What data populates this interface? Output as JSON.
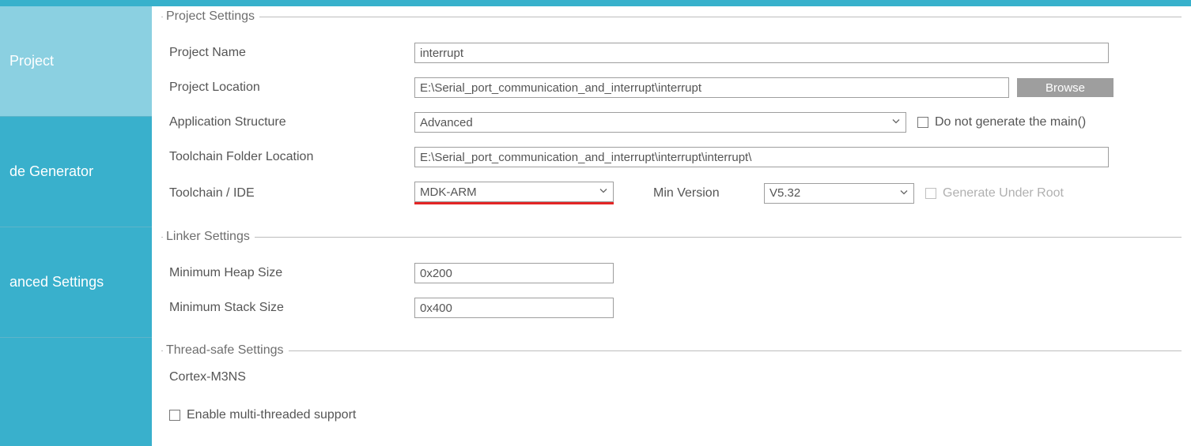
{
  "sidebar": {
    "items": [
      {
        "label": "Project"
      },
      {
        "label": "de Generator"
      },
      {
        "label": "anced Settings"
      }
    ]
  },
  "projectSettings": {
    "legend": "Project Settings",
    "nameLabel": "Project Name",
    "nameValue": "interrupt",
    "locationLabel": "Project Location",
    "locationValue": "E:\\Serial_port_communication_and_interrupt\\interrupt",
    "browseLabel": "Browse",
    "structureLabel": "Application Structure",
    "structureValue": "Advanced",
    "noMainLabel": "Do not generate the main()",
    "toolchainFolderLabel": "Toolchain Folder Location",
    "toolchainFolderValue": "E:\\Serial_port_communication_and_interrupt\\interrupt\\interrupt\\",
    "toolchainLabel": "Toolchain / IDE",
    "toolchainValue": "MDK-ARM",
    "minVersionLabel": "Min Version",
    "minVersionValue": "V5.32",
    "genUnderRootLabel": "Generate Under Root"
  },
  "linkerSettings": {
    "legend": "Linker Settings",
    "heapLabel": "Minimum Heap Size",
    "heapValue": "0x200",
    "stackLabel": "Minimum Stack Size",
    "stackValue": "0x400"
  },
  "threadSettings": {
    "legend": "Thread-safe Settings",
    "coreText": "Cortex-M3NS",
    "enableLabel": "Enable multi-threaded support"
  }
}
